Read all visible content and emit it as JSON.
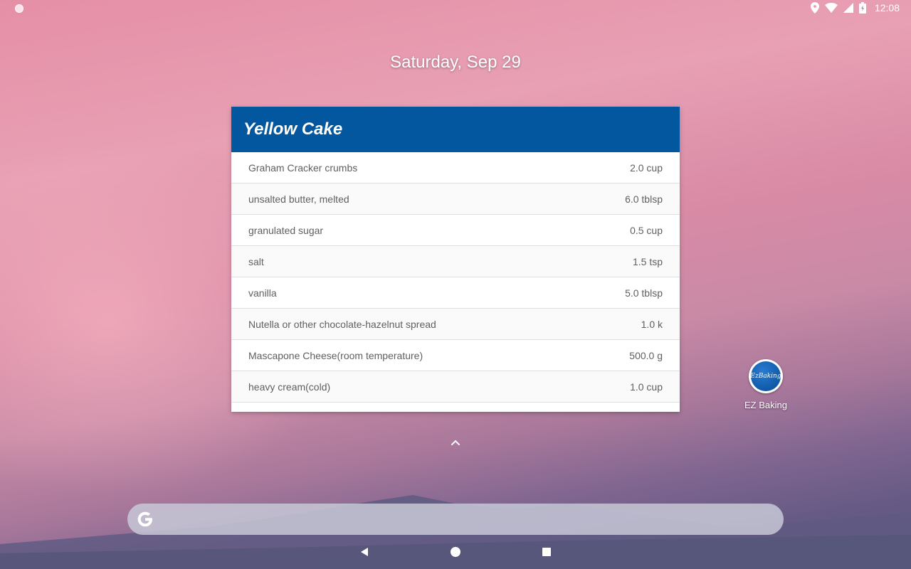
{
  "status_bar": {
    "time": "12:08",
    "icons": [
      "location-icon",
      "wifi-icon",
      "signal-icon",
      "battery-charging-icon"
    ]
  },
  "home": {
    "date": "Saturday, Sep 29"
  },
  "widget": {
    "title": "Yellow Cake",
    "header_color": "#03579f",
    "ingredients": [
      {
        "name": "Graham Cracker crumbs",
        "quantity": "2.0 cup"
      },
      {
        "name": "unsalted butter, melted",
        "quantity": "6.0 tblsp"
      },
      {
        "name": "granulated sugar",
        "quantity": "0.5 cup"
      },
      {
        "name": "salt",
        "quantity": "1.5 tsp"
      },
      {
        "name": "vanilla",
        "quantity": "5.0 tblsp"
      },
      {
        "name": "Nutella or other chocolate-hazelnut spread",
        "quantity": "1.0 k"
      },
      {
        "name": "Mascapone Cheese(room temperature)",
        "quantity": "500.0 g"
      },
      {
        "name": "heavy cream(cold)",
        "quantity": "1.0 cup"
      }
    ]
  },
  "shortcut": {
    "label": "EZ Baking",
    "icon_text": "EzBaking"
  },
  "search": {
    "icon": "google-g-icon"
  },
  "nav": {
    "buttons": [
      "back-icon",
      "home-icon",
      "recents-icon"
    ]
  }
}
